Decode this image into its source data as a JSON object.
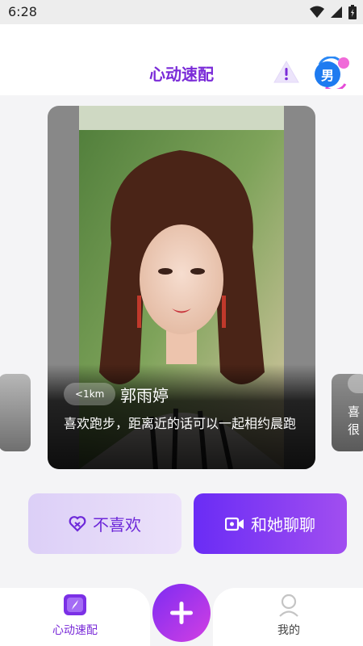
{
  "status_bar": {
    "time": "6:28"
  },
  "header": {
    "title": "心动速配",
    "gender_label": "男"
  },
  "profile": {
    "distance": "<1km",
    "name": "郭雨婷",
    "bio": "喜欢跑步，距离近的话可以一起相约晨跑"
  },
  "side_card_right": {
    "text_line1": "喜",
    "text_line2": "很"
  },
  "actions": {
    "dislike_label": "不喜欢",
    "chat_label": "和她聊聊"
  },
  "tabbar": {
    "tabs": [
      {
        "label": "心动速配",
        "active": true
      },
      {
        "label": "我的",
        "active": false
      }
    ]
  },
  "colors": {
    "accent": "#7a2bd8",
    "chat_gradient_start": "#6a2cf5",
    "chat_gradient_end": "#a14ef0"
  }
}
